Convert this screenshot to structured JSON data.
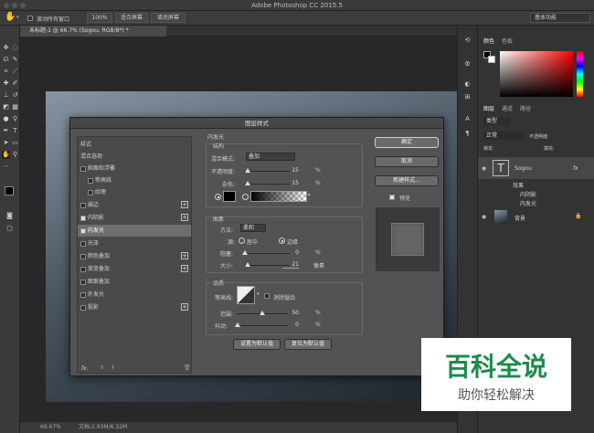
{
  "window": {
    "title": "Adobe Photoshop CC 2015.5"
  },
  "options": {
    "scroll_all_label": "滚动所有窗口",
    "zoom_100": "100%",
    "fit_screen": "适合屏幕",
    "fill_screen": "填充屏幕",
    "workspace": "基本功能"
  },
  "doc_tab": {
    "label": "未标题-1 @ 66.7% (Sogou, RGB/8*) *"
  },
  "status": {
    "zoom": "66.67%",
    "doc": "文档:2.93M/6.32M"
  },
  "panels": {
    "color_tabs": [
      "颜色",
      "色板"
    ],
    "layer_tabs": [
      "图层",
      "通道",
      "路径"
    ],
    "kind": "类型",
    "blend": "正常",
    "opacity_label": "不透明度:",
    "lock_label": "锁定:",
    "fill_label": "填充:",
    "layers": [
      {
        "name": "Sogou",
        "fx": "fx"
      },
      {
        "name": "效果"
      },
      {
        "name": "内阴影"
      },
      {
        "name": "内发光"
      },
      {
        "name": "背景"
      }
    ]
  },
  "dialog": {
    "title": "图层样式",
    "styles_header": "样式",
    "blend_options": "混合选项",
    "items": [
      "斜面和浮雕",
      "等高线",
      "纹理",
      "描边",
      "内阴影",
      "内发光",
      "光泽",
      "颜色叠加",
      "渐变叠加",
      "图案叠加",
      "外发光",
      "投影"
    ],
    "section_title": "内发光",
    "structure": "结构",
    "blend_mode_label": "混合模式:",
    "blend_mode_value": "叠加",
    "opacity_label": "不透明度:",
    "opacity_value": "15",
    "noise_label": "杂色:",
    "noise_value": "15",
    "percent": "%",
    "elements": "图素",
    "method_label": "方法:",
    "method_value": "柔和",
    "source_label": "源:",
    "center": "居中",
    "edge": "边缘",
    "choke_label": "阻塞:",
    "choke_value": "0",
    "size_label": "大小:",
    "size_value": "21",
    "px": "像素",
    "quality": "品质",
    "contour_label": "等高线:",
    "antialias": "消除锯齿",
    "range_label": "范围:",
    "range_value": "50",
    "jitter_label": "抖动:",
    "jitter_value": "0",
    "set_default": "设置为默认值",
    "reset_default": "复位为默认值",
    "ok": "确定",
    "cancel": "取消",
    "new_style": "新建样式...",
    "preview": "预览",
    "fx": "fx."
  },
  "watermark": {
    "big": "百科全说",
    "small": "助你轻松解决"
  }
}
